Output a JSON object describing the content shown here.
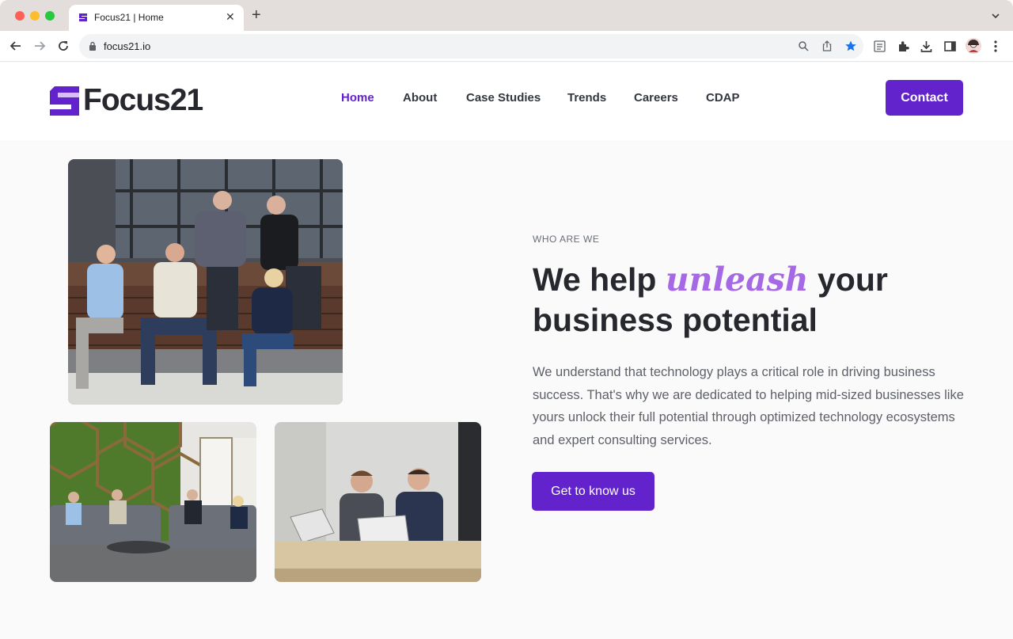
{
  "browser": {
    "tab_title": "Focus21 | Home",
    "tab_close": "✕",
    "new_tab": "+",
    "url": "focus21.io",
    "icons": [
      "back-icon",
      "forward-icon",
      "reload-icon",
      "lock-icon",
      "zoom-icon",
      "share-icon",
      "bookmark-star-icon",
      "reader-mode-icon",
      "extensions-icon",
      "download-icon",
      "side-panel-icon",
      "profile-avatar-icon",
      "menu-icon"
    ]
  },
  "site": {
    "brand": "Focus21",
    "brand_color": "#6222cc",
    "nav": [
      {
        "label": "Home",
        "active": true
      },
      {
        "label": "About"
      },
      {
        "label": "Case Studies"
      },
      {
        "label": "Trends"
      },
      {
        "label": "Careers"
      },
      {
        "label": "CDAP"
      }
    ],
    "contact_label": "Contact"
  },
  "hero": {
    "eyebrow": "WHO ARE WE",
    "headline_part1": "We help ",
    "headline_accent": "unleash",
    "headline_part2": " your business potential",
    "accent_color": "#a569e6",
    "body": "We understand that technology plays a critical role in driving business success. That's why we are dedicated to helping mid-sized businesses like yours unlock their full potential through optimized technology ecosystems and expert consulting services.",
    "cta_label": "Get to know us"
  }
}
